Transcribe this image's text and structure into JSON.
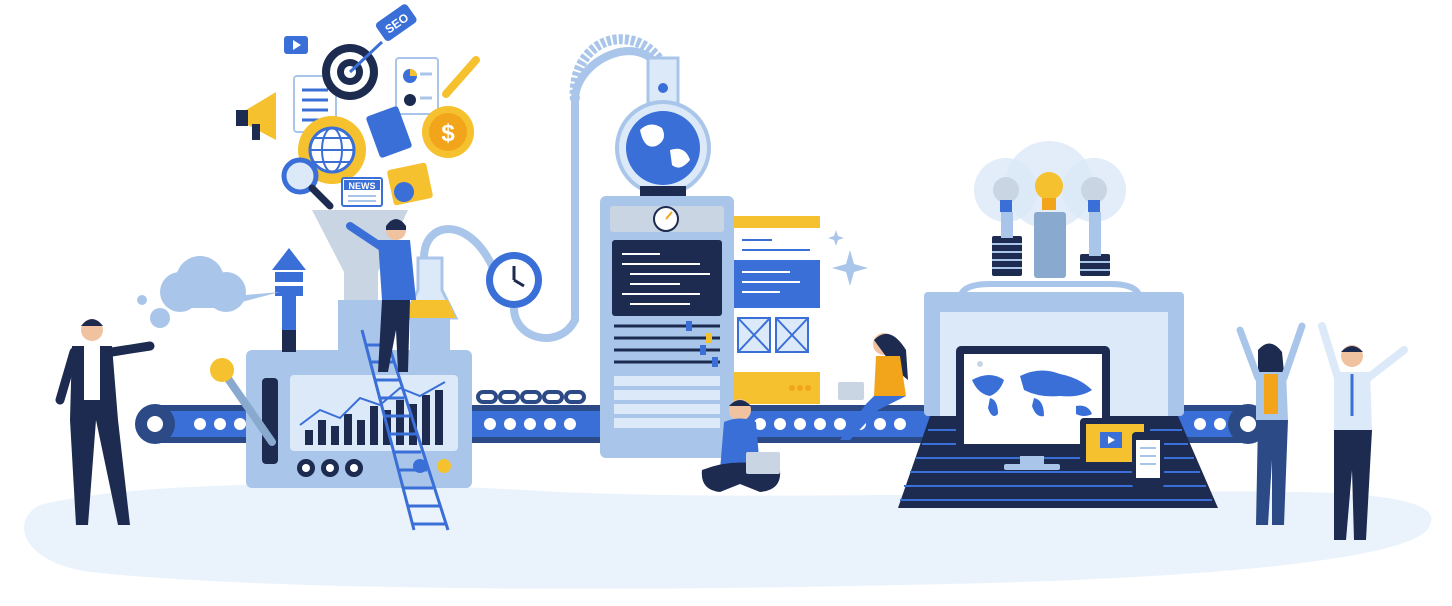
{
  "labels": {
    "seo_tag": "SEO",
    "news_label": "NEWS",
    "dollar_sign": "$"
  },
  "colors": {
    "navy": "#1c2b4f",
    "blue": "#3a6fd8",
    "light_blue": "#a9c6ea",
    "pale_blue": "#dbe9f8",
    "ground": "#eaf3fc",
    "yellow": "#f5c12e",
    "orange": "#f2a51a",
    "gray": "#c9d5e3",
    "white": "#ffffff"
  },
  "icons": [
    "gear-icon",
    "globe-icon",
    "target-icon",
    "megaphone-icon",
    "magnifier-icon",
    "dollar-coin-icon",
    "seo-tag-icon",
    "video-play-icon",
    "pencil-icon",
    "news-card-icon",
    "clock-gauge-icon",
    "world-map-icon",
    "lightbulb-icon"
  ]
}
